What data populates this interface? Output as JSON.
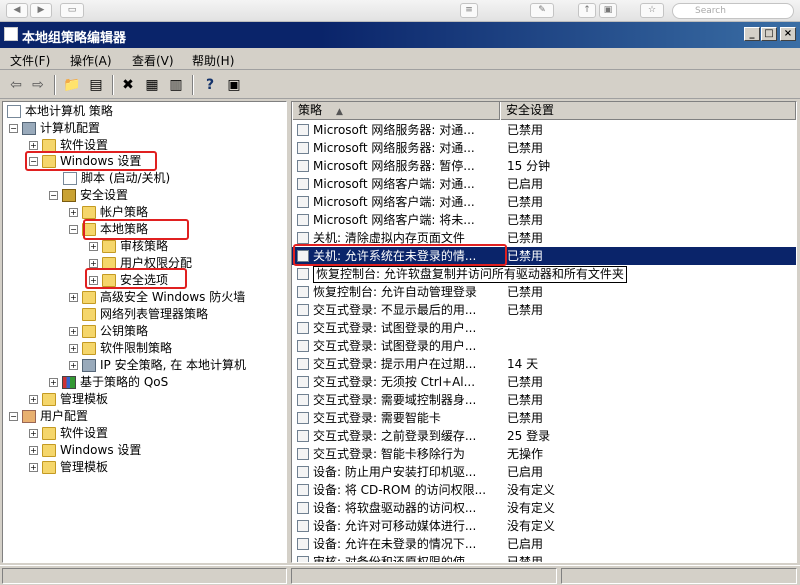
{
  "browser": {
    "search_placeholder": "Search"
  },
  "window": {
    "title": "本地组策略编辑器"
  },
  "menu": {
    "file": "文件(F)",
    "action": "操作(A)",
    "view": "查看(V)",
    "help": "帮助(H)"
  },
  "tree": {
    "root": "本地计算机 策略",
    "computer_config": "计算机配置",
    "software_settings": "软件设置",
    "windows_settings": "Windows 设置",
    "scripts": "脚本 (启动/关机)",
    "security_settings": "安全设置",
    "account_policies": "帐户策略",
    "local_policies": "本地策略",
    "audit_policy": "审核策略",
    "user_rights": "用户权限分配",
    "security_options": "安全选项",
    "firewall": "高级安全 Windows 防火墙",
    "network_list": "网络列表管理器策略",
    "public_key": "公钥策略",
    "software_restriction": "软件限制策略",
    "ipsec": "IP 安全策略, 在 本地计算机",
    "qos": "基于策略的 QoS",
    "admin_templates": "管理模板",
    "user_config": "用户配置",
    "u_software_settings": "软件设置",
    "u_windows_settings": "Windows 设置",
    "u_admin_templates": "管理模板"
  },
  "list": {
    "col_policy": "策略",
    "col_setting": "安全设置",
    "rows": [
      {
        "policy": "Microsoft 网络服务器: 对通...",
        "setting": "已禁用"
      },
      {
        "policy": "Microsoft 网络服务器: 对通...",
        "setting": "已禁用"
      },
      {
        "policy": "Microsoft 网络服务器: 暂停...",
        "setting": "15 分钟"
      },
      {
        "policy": "Microsoft 网络客户端: 对通...",
        "setting": "已启用"
      },
      {
        "policy": "Microsoft 网络客户端: 对通...",
        "setting": "已禁用"
      },
      {
        "policy": "Microsoft 网络客户端: 将未...",
        "setting": "已禁用"
      },
      {
        "policy": "关机: 清除虚拟内存页面文件",
        "setting": "已禁用"
      },
      {
        "policy": "关机: 允许系统在未登录的情...",
        "setting": "已禁用"
      },
      {
        "policy": "恢复控制台: 允许软盘复制并访问所有驱动器和所有文件夹",
        "setting": ""
      },
      {
        "policy": "恢复控制台: 允许自动管理登录",
        "setting": "已禁用"
      },
      {
        "policy": "交互式登录: 不显示最后的用...",
        "setting": "已禁用"
      },
      {
        "policy": "交互式登录: 试图登录的用户...",
        "setting": ""
      },
      {
        "policy": "交互式登录: 试图登录的用户...",
        "setting": ""
      },
      {
        "policy": "交互式登录: 提示用户在过期...",
        "setting": "14 天"
      },
      {
        "policy": "交互式登录: 无须按 Ctrl+Al...",
        "setting": "已禁用"
      },
      {
        "policy": "交互式登录: 需要域控制器身...",
        "setting": "已禁用"
      },
      {
        "policy": "交互式登录: 需要智能卡",
        "setting": "已禁用"
      },
      {
        "policy": "交互式登录: 之前登录到缓存...",
        "setting": "25 登录"
      },
      {
        "policy": "交互式登录: 智能卡移除行为",
        "setting": "无操作"
      },
      {
        "policy": "设备: 防止用户安装打印机驱...",
        "setting": "已启用"
      },
      {
        "policy": "设备: 将 CD-ROM 的访问权限...",
        "setting": "没有定义"
      },
      {
        "policy": "设备: 将软盘驱动器的访问权...",
        "setting": "没有定义"
      },
      {
        "policy": "设备: 允许对可移动媒体进行...",
        "setting": "没有定义"
      },
      {
        "policy": "设备: 允许在未登录的情况下...",
        "setting": "已启用"
      },
      {
        "policy": "审核: 对备份和还原权限的使...",
        "setting": "已禁用"
      }
    ]
  }
}
